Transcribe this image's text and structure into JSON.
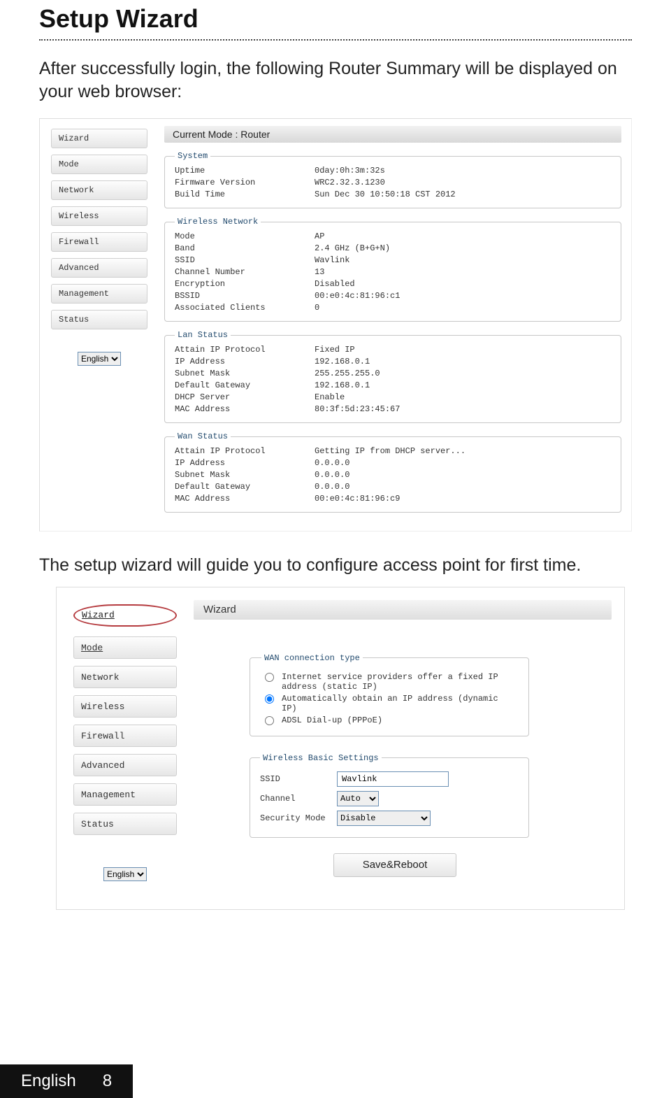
{
  "title": "Setup Wizard",
  "intro": "After successfully login, the following Router Summary will be displayed on your web browser:",
  "intro2": "The setup wizard will guide you to configure access point for first time.",
  "sidebar": {
    "items": [
      "Wizard",
      "Mode",
      "Network",
      "Wireless",
      "Firewall",
      "Advanced",
      "Management",
      "Status"
    ],
    "lang": "English"
  },
  "s1": {
    "mode_label": "Current Mode :  Router",
    "system": {
      "legend": "System",
      "rows": [
        [
          "Uptime",
          "0day:0h:3m:32s"
        ],
        [
          "Firmware Version",
          "WRC2.32.3.1230"
        ],
        [
          "Build Time",
          "Sun Dec 30 10:50:18 CST 2012"
        ]
      ]
    },
    "wireless": {
      "legend": "Wireless Network",
      "rows": [
        [
          "Mode",
          "AP"
        ],
        [
          "Band",
          "2.4 GHz (B+G+N)"
        ],
        [
          "SSID",
          "Wavlink"
        ],
        [
          "Channel Number",
          "13"
        ],
        [
          "Encryption",
          "Disabled"
        ],
        [
          "BSSID",
          "00:e0:4c:81:96:c1"
        ],
        [
          "Associated Clients",
          "0"
        ]
      ]
    },
    "lan": {
      "legend": "Lan Status",
      "rows": [
        [
          "Attain IP Protocol",
          "Fixed IP"
        ],
        [
          "IP Address",
          "192.168.0.1"
        ],
        [
          "Subnet Mask",
          "255.255.255.0"
        ],
        [
          "Default Gateway",
          "192.168.0.1"
        ],
        [
          "DHCP Server",
          "Enable"
        ],
        [
          "MAC Address",
          "80:3f:5d:23:45:67"
        ]
      ]
    },
    "wan": {
      "legend": "Wan Status",
      "rows": [
        [
          "Attain IP Protocol",
          "Getting IP from DHCP server..."
        ],
        [
          "IP Address",
          "0.0.0.0"
        ],
        [
          "Subnet Mask",
          "0.0.0.0"
        ],
        [
          "Default Gateway",
          "0.0.0.0"
        ],
        [
          "MAC Address",
          "00:e0:4c:81:96:c9"
        ]
      ]
    }
  },
  "s2": {
    "heading": "Wizard",
    "wan_legend": "WAN connection type",
    "opts": {
      "static": "Internet service providers offer a fixed IP address (static IP)",
      "dynamic": "Automatically obtain an IP address (dynamic IP)",
      "pppoe": "ADSL Dial-up (PPPoE)"
    },
    "wbs_legend": "Wireless Basic Settings",
    "ssid_label": "SSID",
    "ssid_value": "Wavlink",
    "channel_label": "Channel",
    "channel_value": "Auto",
    "sec_label": "Security Mode",
    "sec_value": "Disable",
    "save_label": "Save&Reboot",
    "lang": "English"
  },
  "footer": {
    "lang": "English",
    "page": "8"
  }
}
